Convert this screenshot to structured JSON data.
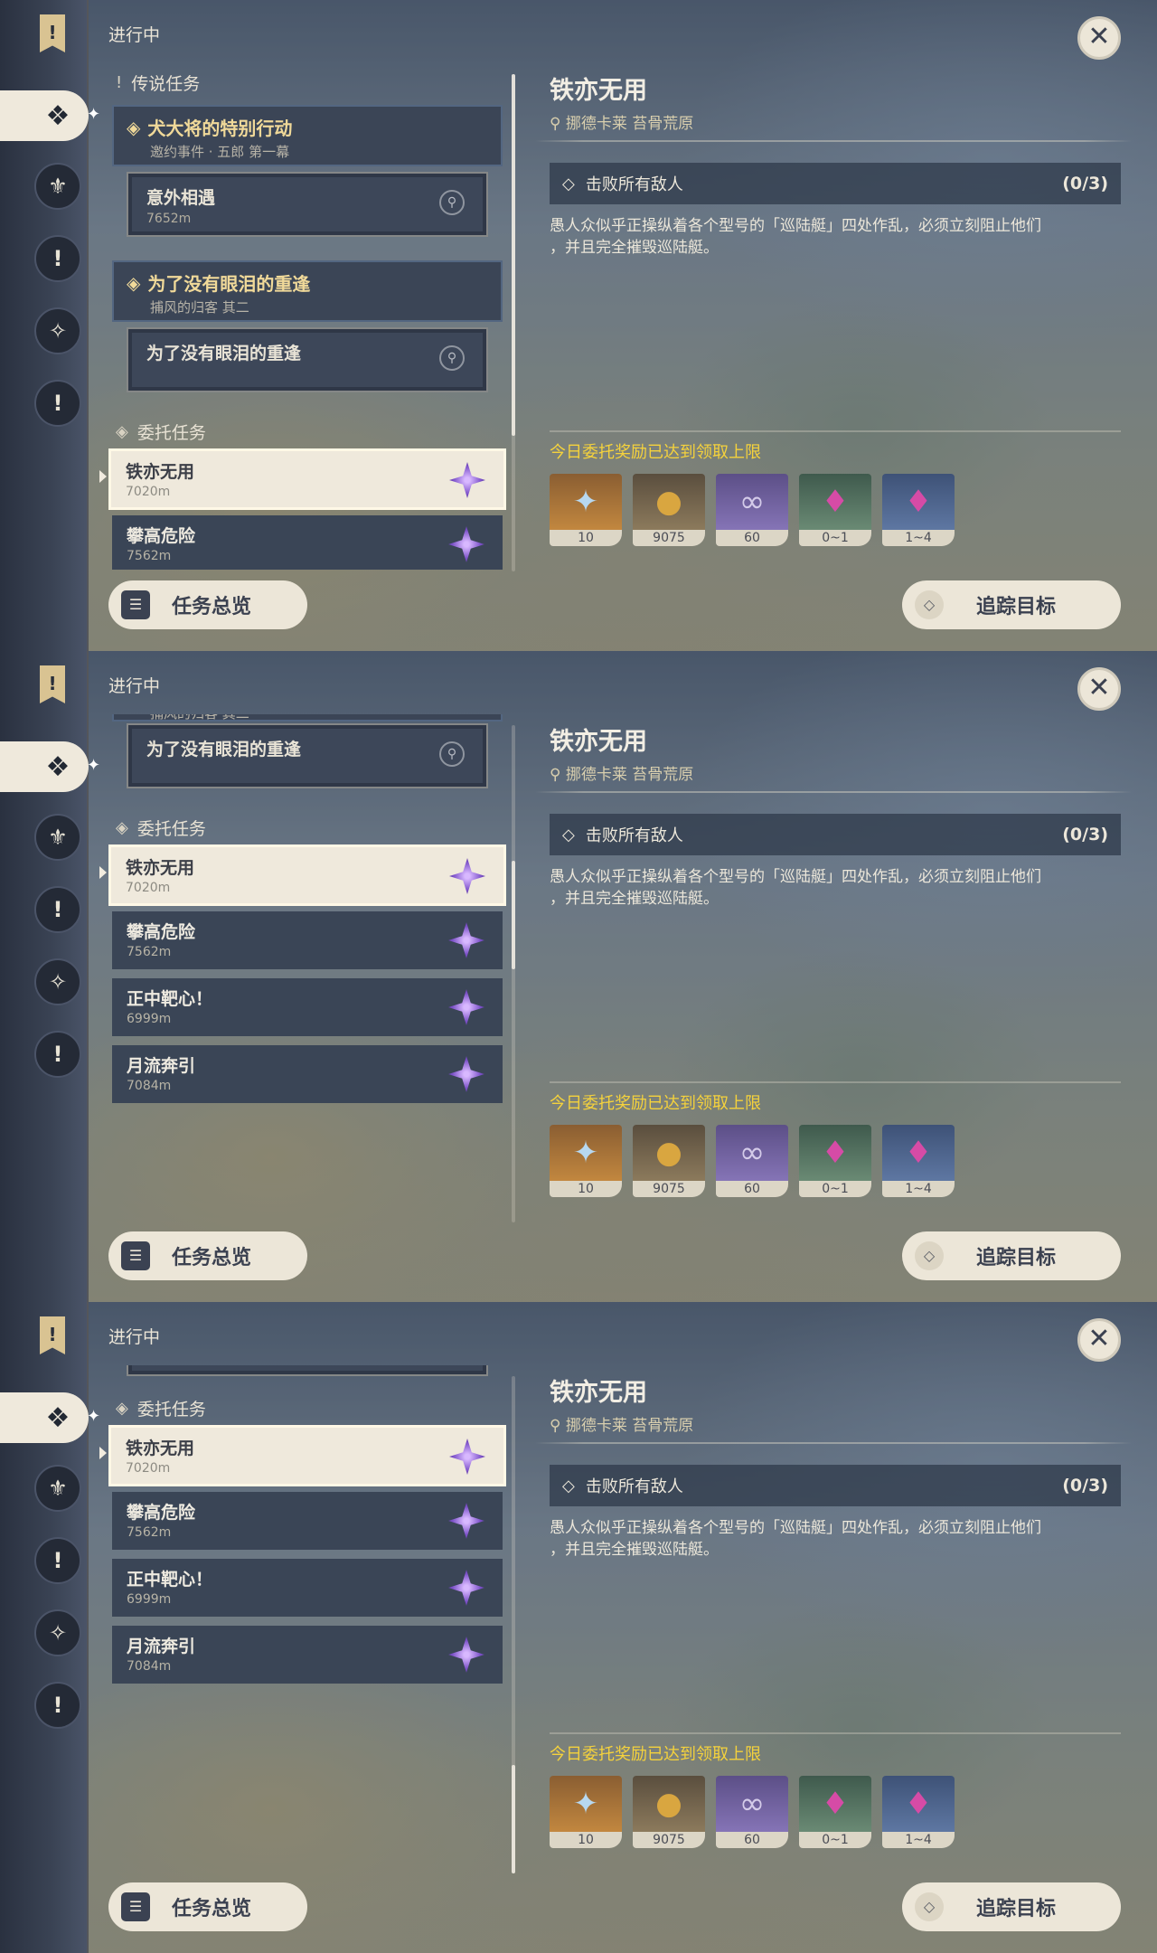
{
  "panels": [
    {
      "status_label": "进行中",
      "legend_section": "传说任务",
      "legend_quests": [
        {
          "title": "犬大将的特别行动",
          "subtitle": "邀约事件 · 五郎 第一幕",
          "step": "意外相遇",
          "distance": "7652m"
        },
        {
          "title": "为了没有眼泪的重逢",
          "subtitle": "捕风的归客 其二",
          "step": "为了没有眼泪的重逢"
        }
      ],
      "commission_section": "委托任务",
      "commissions": [
        {
          "name": "铁亦无用",
          "distance": "7020m"
        },
        {
          "name": "攀高危险",
          "distance": "7562m"
        }
      ]
    },
    {
      "status_label": "进行中",
      "partial_subtitle": "捕风的归客 其二",
      "partial_step": "为了没有眼泪的重逢",
      "commission_section": "委托任务",
      "commissions": [
        {
          "name": "铁亦无用",
          "distance": "7020m"
        },
        {
          "name": "攀高危险",
          "distance": "7562m"
        },
        {
          "name": "正中靶心！",
          "distance": "6999m"
        },
        {
          "name": "月流奔引",
          "distance": "7084m"
        }
      ]
    },
    {
      "status_label": "进行中",
      "commission_section": "委托任务",
      "commissions": [
        {
          "name": "铁亦无用",
          "distance": "7020m"
        },
        {
          "name": "攀高危险",
          "distance": "7562m"
        },
        {
          "name": "正中靶心！",
          "distance": "6999m"
        },
        {
          "name": "月流奔引",
          "distance": "7084m"
        }
      ]
    }
  ],
  "detail": {
    "title": "铁亦无用",
    "location": "挪德卡莱 苔骨荒原",
    "objective": "击败所有敌人",
    "progress": "(0/3)",
    "description_line1": "愚人众似乎正操纵着各个型号的「巡陆艇」四处作乱，必须立刻阻止他们",
    "description_line2": "，并且完全摧毁巡陆艇。",
    "reward_notice": "今日委托奖励已达到领取上限",
    "rewards": [
      {
        "icon": "primogem-icon",
        "count": "10"
      },
      {
        "icon": "mora-icon",
        "count": "9075"
      },
      {
        "icon": "companionship-exp-icon",
        "count": "60"
      },
      {
        "icon": "crystal-chunk-icon",
        "count": "0~1"
      },
      {
        "icon": "crystal-cluster-icon",
        "count": "1~4"
      }
    ]
  },
  "buttons": {
    "overview": "任务总览",
    "track": "追踪目标"
  }
}
